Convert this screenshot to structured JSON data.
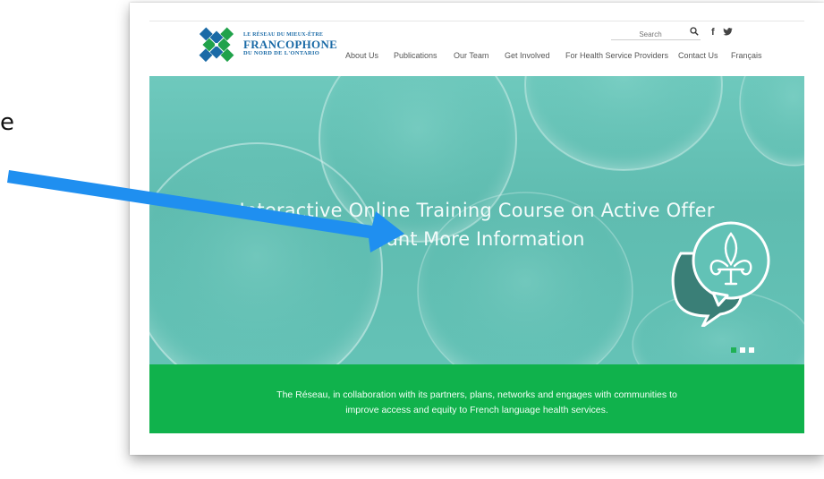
{
  "annotation": {
    "left_text": "e"
  },
  "logo": {
    "line1": "LE RÉSEAU DU MIEUX-ÊTRE",
    "line2": "FRANCOPHONE",
    "line3": "DU NORD DE L'ONTARIO"
  },
  "search": {
    "placeholder": "Search"
  },
  "social": {
    "facebook": "f",
    "twitter": "twitter"
  },
  "nav": {
    "items": [
      {
        "label": "About Us"
      },
      {
        "label": "Publications"
      },
      {
        "label": "Our Team"
      },
      {
        "label": "Get Involved"
      },
      {
        "label": "For Health Service Providers"
      },
      {
        "label": "Contact Us"
      },
      {
        "label": "Français"
      }
    ]
  },
  "hero": {
    "title": "Interactive Online Training Course on Active Offer",
    "subtitle": "Want More Information",
    "slides": {
      "count": 3,
      "active": 1
    }
  },
  "band": {
    "text_line1": "The Réseau, in collaboration with its partners, plans, networks and engages with communities to",
    "text_line2": "improve access and equity to French language health services."
  },
  "colors": {
    "brand_blue": "#1a6aa6",
    "brand_green": "#10b24c",
    "hero_teal": "#64c2b6",
    "arrow_blue": "#1f8ff0"
  }
}
